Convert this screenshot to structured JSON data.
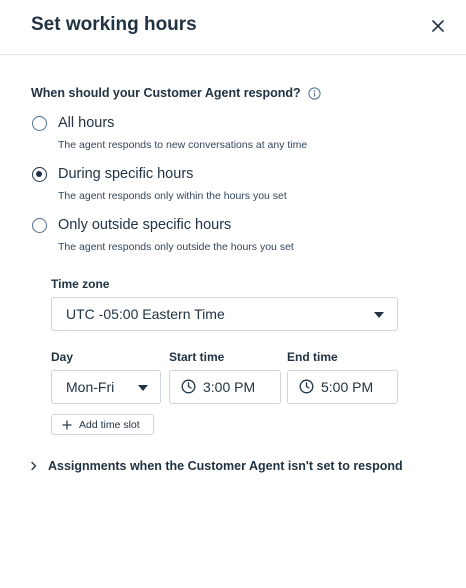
{
  "dialog": {
    "title": "Set working hours"
  },
  "question": {
    "text": "When should your Customer Agent respond?"
  },
  "options": [
    {
      "label": "All hours",
      "description": "The agent responds to new conversations at any time",
      "selected": false
    },
    {
      "label": "During specific hours",
      "description": "The agent responds only within the hours you set",
      "selected": true
    },
    {
      "label": "Only outside specific hours",
      "description": "The agent responds only outside the hours you set",
      "selected": false
    }
  ],
  "timezone": {
    "label": "Time zone",
    "value": "UTC -05:00 Eastern Time"
  },
  "slot": {
    "day_label": "Day",
    "day_value": "Mon-Fri",
    "start_label": "Start time",
    "start_value": "3:00 PM",
    "end_label": "End time",
    "end_value": "5:00 PM"
  },
  "add_slot": {
    "label": "Add time slot"
  },
  "assignments": {
    "label": "Assignments when the Customer Agent isn't set to respond"
  },
  "icons": {
    "close": "close-icon",
    "info": "info-icon",
    "caret": "caret-down-icon",
    "clock": "clock-icon",
    "plus": "plus-icon",
    "chevron": "chevron-right-icon"
  }
}
